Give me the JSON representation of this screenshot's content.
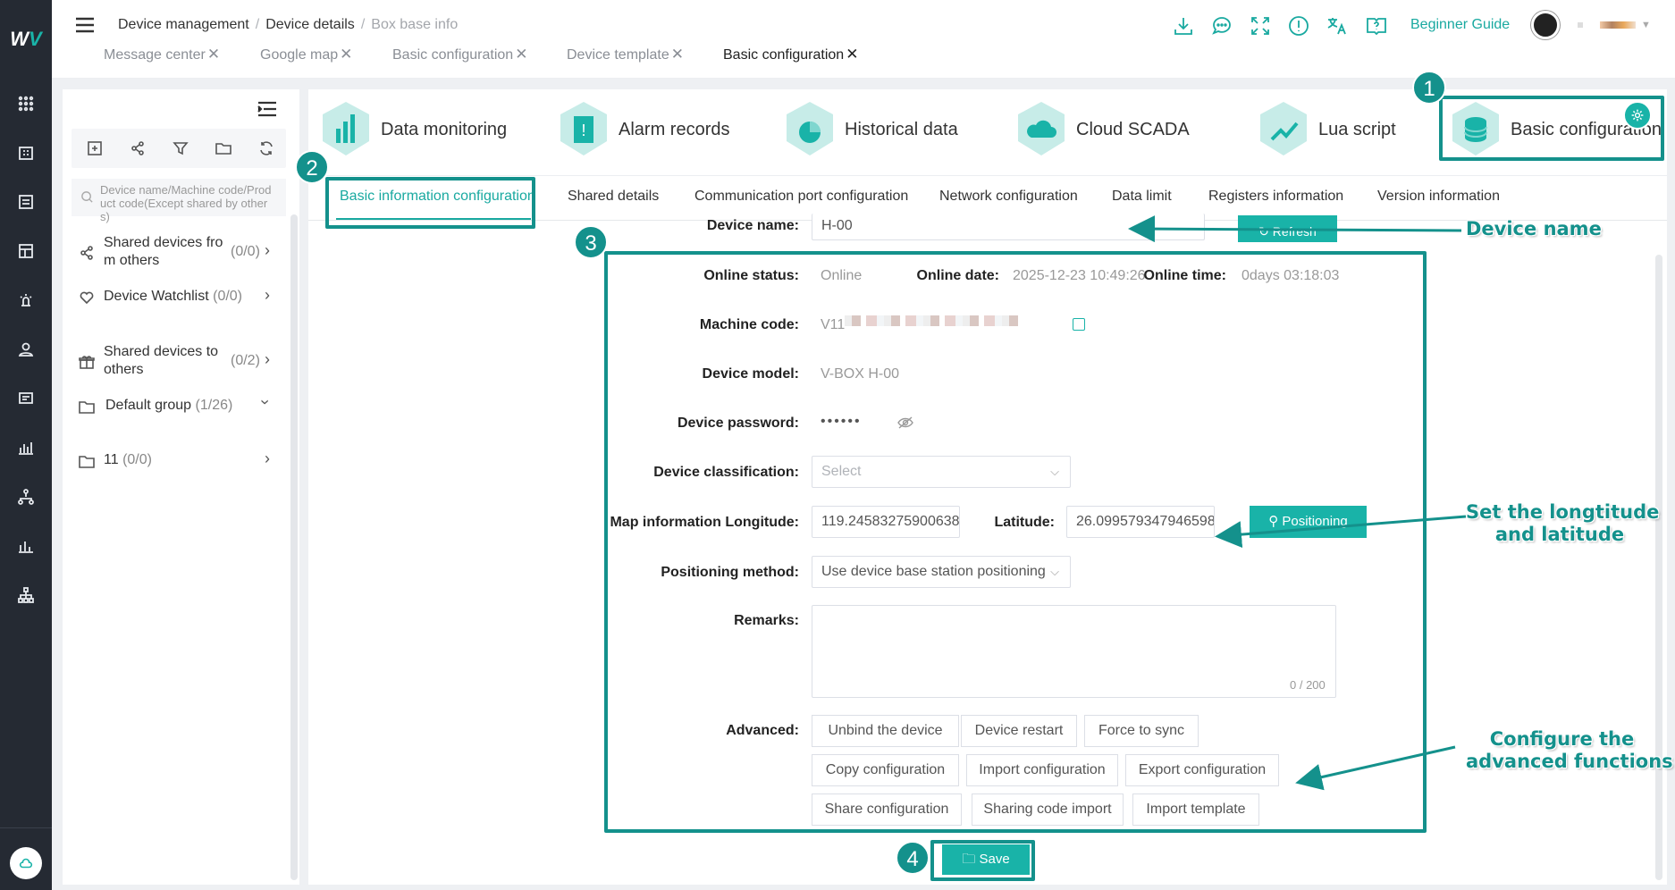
{
  "header": {
    "breadcrumb": [
      "Device management",
      "Device details",
      "Box base info"
    ],
    "beginner_guide": "Beginner Guide",
    "open_tabs": [
      {
        "label": "Message center",
        "active": false
      },
      {
        "label": "Google map",
        "active": false
      },
      {
        "label": "Basic configuration",
        "active": false
      },
      {
        "label": "Device template",
        "active": false
      },
      {
        "label": "Basic configuration",
        "active": true
      }
    ],
    "icons": [
      "download-icon",
      "chat-icon",
      "fullscreen-icon",
      "alert-icon",
      "translate-icon",
      "help-book-icon"
    ]
  },
  "sidebar": {
    "search_placeholder": "Device name/Machine code/Product code(Except shared by others)",
    "items": [
      {
        "label": "Shared devices fro",
        "label2": "m others",
        "count": "(0/0)",
        "icon": "share-icon"
      },
      {
        "label": "Device Watchlist",
        "count": "(0/0)",
        "icon": "heart-icon"
      },
      {
        "label": "Shared devices to",
        "label2": "others",
        "count": "(0/2)",
        "icon": "gift-icon"
      },
      {
        "label": "Default group",
        "count": "(1/26)",
        "icon": "folder-icon"
      },
      {
        "label": "11",
        "count": "(0/0)",
        "icon": "folder-icon"
      }
    ]
  },
  "main_tabs": [
    "Data monitoring",
    "Alarm records",
    "Historical data",
    "Cloud SCADA",
    "Lua script",
    "Basic configuration"
  ],
  "sub_tabs": [
    "Basic information configuration",
    "Shared details",
    "Communication port configuration",
    "Network configuration",
    "Data limit",
    "Registers information",
    "Version information"
  ],
  "form": {
    "device_name_label": "Device name:",
    "device_name": "H-00",
    "refresh_label": "Refresh",
    "online_status_label": "Online status:",
    "online_status": "Online",
    "online_date_label": "Online date:",
    "online_date": "2025-12-23 10:49:26",
    "online_time_label": "Online time:",
    "online_time": "0days 03:18:03",
    "machine_code_label": "Machine code:",
    "machine_code": "V11",
    "device_model_label": "Device model:",
    "device_model": "V-BOX H-00",
    "device_password_label": "Device password:",
    "device_password": "••••••",
    "classification_label": "Device classification:",
    "classification_placeholder": "Select",
    "longitude_label": "Map information Longitude:",
    "longitude": "119.24583275900638",
    "latitude_label": "Latitude:",
    "latitude": "26.099579347946598",
    "positioning_button": "Positioning",
    "positioning_method_label": "Positioning method:",
    "positioning_method": "Use device base station positioning",
    "remarks_label": "Remarks:",
    "remarks_counter": "0 / 200",
    "advanced_label": "Advanced:",
    "advanced_buttons": [
      "Unbind the device",
      "Device restart",
      "Force to sync",
      "Copy configuration",
      "Import configuration",
      "Export configuration",
      "Share configuration",
      "Sharing code import",
      "Import template"
    ],
    "save_button": "Save"
  },
  "annotations": {
    "badges": [
      "1",
      "2",
      "3",
      "4"
    ],
    "device_name": "Device name",
    "lat_lng_line1": "Set the longtitude",
    "lat_lng_line2": "and latitude",
    "advanced_line1": "Configure the",
    "advanced_line2": "advanced functions"
  },
  "colors": {
    "accent": "#19b3a8",
    "annotation": "#14918c",
    "nav_bg": "#252a33"
  }
}
